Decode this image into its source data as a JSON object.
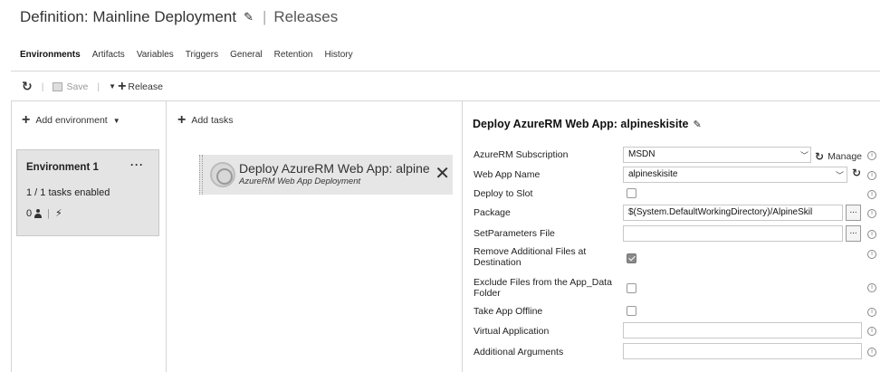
{
  "header": {
    "title": "Definition: Mainline Deployment",
    "separator": "|",
    "releases_link": "Releases"
  },
  "tabs": [
    {
      "label": "Environments",
      "active": true
    },
    {
      "label": "Artifacts",
      "active": false
    },
    {
      "label": "Variables",
      "active": false
    },
    {
      "label": "Triggers",
      "active": false
    },
    {
      "label": "General",
      "active": false
    },
    {
      "label": "Retention",
      "active": false
    },
    {
      "label": "History",
      "active": false
    }
  ],
  "toolbar": {
    "refresh_icon": "refresh-icon",
    "save_label": "Save",
    "release_label": "Release",
    "separator": "|"
  },
  "environments": {
    "add_label": "Add environment",
    "card": {
      "name": "Environment 1",
      "more": "···",
      "tasks_status": "1 / 1 tasks enabled",
      "approvers_count": "0",
      "separator": "|"
    }
  },
  "tasks": {
    "add_label": "Add tasks",
    "items": [
      {
        "title": "Deploy AzureRM Web App: alpine",
        "subtitle": "AzureRM Web App Deployment",
        "close": "✕"
      }
    ]
  },
  "panel": {
    "title": "Deploy AzureRM Web App: alpineskisite",
    "fields": {
      "subscription": {
        "label": "AzureRM Subscription",
        "value": "MSDN",
        "manage_label": "Manage"
      },
      "web_app_name": {
        "label": "Web App Name",
        "value": "alpineskisite"
      },
      "deploy_to_slot": {
        "label": "Deploy to Slot",
        "checked": false
      },
      "package": {
        "label": "Package",
        "value": "$(System.DefaultWorkingDirectory)/AlpineSkil",
        "browse": "..."
      },
      "set_parameters_file": {
        "label": "SetParameters File",
        "value": "",
        "browse": "..."
      },
      "remove_additional_files": {
        "label": "Remove Additional Files at Destination",
        "checked": true
      },
      "exclude_app_data": {
        "label": "Exclude Files from the App_Data Folder",
        "checked": false
      },
      "take_app_offline": {
        "label": "Take App Offline",
        "checked": false
      },
      "virtual_application": {
        "label": "Virtual Application",
        "value": ""
      },
      "additional_arguments": {
        "label": "Additional Arguments",
        "value": ""
      }
    },
    "info_glyph": "i"
  }
}
